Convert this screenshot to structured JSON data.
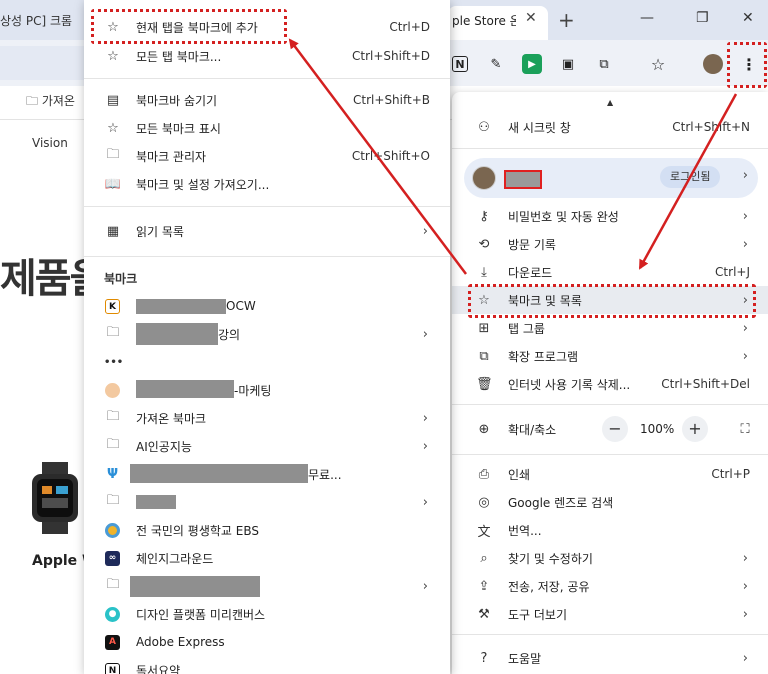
{
  "browser": {
    "left_tab_title": "상성 PC] 크롬",
    "active_tab_title": "ple Store 온",
    "tab_close": "✕",
    "new_tab": "+",
    "minimize": "—",
    "restore": "❐",
    "close": "✕",
    "bookmark_folder": "가져온",
    "page_text_vision": "Vision",
    "page_heading": "제품을",
    "page_product": "Apple W"
  },
  "main_menu": {
    "incognito": {
      "label": "새 시크릿 창",
      "shortcut": "Ctrl+Shift+N"
    },
    "profile": {
      "login_label": "로그인됨"
    },
    "passwords": {
      "label": "비밀번호 및 자동 완성"
    },
    "history": {
      "label": "방문 기록"
    },
    "downloads": {
      "label": "다운로드",
      "shortcut": "Ctrl+J"
    },
    "bookmarks": {
      "label": "북마크 및 목록"
    },
    "tab_groups": {
      "label": "탭 그룹"
    },
    "extensions": {
      "label": "확장 프로그램"
    },
    "clear_data": {
      "label": "인터넷 사용 기록 삭제...",
      "shortcut": "Ctrl+Shift+Del"
    },
    "zoom": {
      "label": "확대/축소",
      "minus": "−",
      "value": "100%",
      "plus": "+"
    },
    "print": {
      "label": "인쇄",
      "shortcut": "Ctrl+P"
    },
    "lens": {
      "label": "Google 렌즈로 검색"
    },
    "translate": {
      "label": "번역..."
    },
    "find": {
      "label": "찾기 및 수정하기"
    },
    "cast": {
      "label": "전송, 저장, 공유"
    },
    "more_tools": {
      "label": "도구 더보기"
    },
    "help": {
      "label": "도움말"
    }
  },
  "bookmark_menu": {
    "add_current": {
      "label": "현재 탭을 북마크에 추가",
      "shortcut": "Ctrl+D"
    },
    "bookmark_all": {
      "label": "모든 탭 북마크...",
      "shortcut": "Ctrl+Shift+D"
    },
    "hide_bar": {
      "label": "북마크바 숨기기",
      "shortcut": "Ctrl+Shift+B"
    },
    "show_all": {
      "label": "모든 북마크 표시"
    },
    "manager": {
      "label": "북마크 관리자",
      "shortcut": "Ctrl+Shift+O"
    },
    "import": {
      "label": "북마크 및 설정 가져오기..."
    },
    "reading_list": {
      "label": "읽기 목록"
    },
    "section_title": "북마크",
    "items": [
      {
        "label": "OCW"
      },
      {
        "label": "강의"
      },
      {
        "label": ""
      },
      {
        "label": "-마케팅"
      },
      {
        "label": "가져온 북마크"
      },
      {
        "label": "AI인공지능"
      },
      {
        "label": "무료..."
      },
      {
        "label": ""
      },
      {
        "label": "전 국민의 평생학교 EBS"
      },
      {
        "label": "체인지그라운드"
      },
      {
        "label": ""
      },
      {
        "label": "디자인 플랫폼 미리캔버스"
      },
      {
        "label": "Adobe Express"
      },
      {
        "label": "독서요약"
      }
    ]
  },
  "colors": {
    "annotation_red": "#d42020",
    "menu_bg": "#ffffff",
    "profile_pill": "#e7edf8"
  }
}
